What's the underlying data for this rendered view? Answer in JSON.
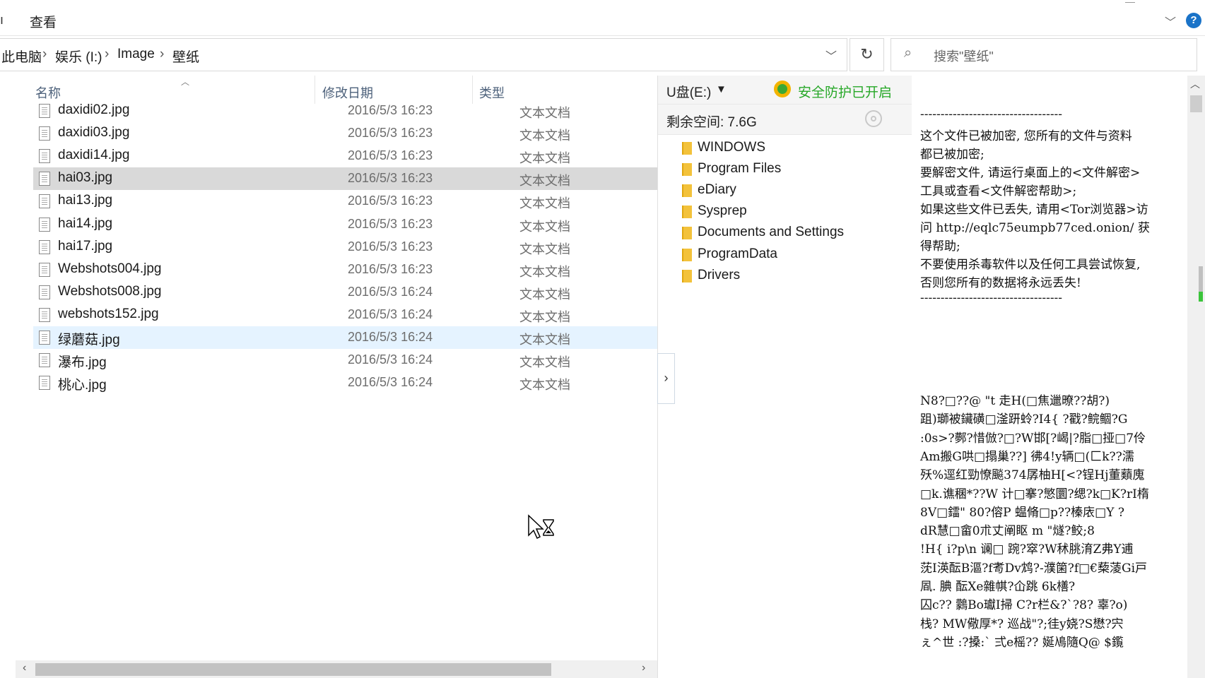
{
  "ribbon": {
    "tab_view": "查看",
    "left_edge": "ı"
  },
  "address": {
    "crumbs": [
      "此电脑",
      "娱乐 (I:)",
      "Image",
      "壁纸"
    ]
  },
  "search": {
    "placeholder": "搜索\"壁纸\""
  },
  "columns": {
    "name": "名称",
    "date": "修改日期",
    "type": "类型"
  },
  "files": [
    {
      "name": "daxidi02.jpg",
      "date": "2016/5/3 16:23",
      "type": "文本文档"
    },
    {
      "name": "daxidi03.jpg",
      "date": "2016/5/3 16:23",
      "type": "文本文档"
    },
    {
      "name": "daxidi14.jpg",
      "date": "2016/5/3 16:23",
      "type": "文本文档"
    },
    {
      "name": "hai03.jpg",
      "date": "2016/5/3 16:23",
      "type": "文本文档"
    },
    {
      "name": "hai13.jpg",
      "date": "2016/5/3 16:23",
      "type": "文本文档"
    },
    {
      "name": "hai14.jpg",
      "date": "2016/5/3 16:23",
      "type": "文本文档"
    },
    {
      "name": "hai17.jpg",
      "date": "2016/5/3 16:23",
      "type": "文本文档"
    },
    {
      "name": "Webshots004.jpg",
      "date": "2016/5/3 16:23",
      "type": "文本文档"
    },
    {
      "name": "Webshots008.jpg",
      "date": "2016/5/3 16:24",
      "type": "文本文档"
    },
    {
      "name": "webshots152.jpg",
      "date": "2016/5/3 16:24",
      "type": "文本文档"
    },
    {
      "name": "绿蘑菇.jpg",
      "date": "2016/5/3 16:24",
      "type": "文本文档"
    },
    {
      "name": "瀑布.jpg",
      "date": "2016/5/3 16:24",
      "type": "文本文档"
    },
    {
      "name": "桃心.jpg",
      "date": "2016/5/3 16:24",
      "type": "文本文档"
    }
  ],
  "usb": {
    "drive": "U盘(E:)",
    "security": "安全防护已开启",
    "space": "剩余空间: 7.6G",
    "folders": [
      "WINDOWS",
      "Program Files",
      "eDiary",
      "Sysprep",
      "Documents and Settings",
      "ProgramData",
      "Drivers"
    ]
  },
  "note": {
    "lines": [
      "-----------------------------------",
      "这个文件已被加密, 您所有的文件与资料",
      "都已被加密;",
      "要解密文件, 请运行桌面上的<文件解密>",
      "工具或查看<文件解密帮助>;",
      "如果这些文件已丢失, 请用<Tor浏览器>访",
      "问 http://eqlc75eumpb77ced.onion/ 获",
      "得帮助;",
      "不要使用杀毒软件以及任何工具尝试恢复,",
      "否则您所有的数据将永远丢失!",
      "-----------------------------------"
    ],
    "garbage": [
      "N8?□??@ \"t  走H(□焦邋暸??胡?)",
      "跙)瑡被鑶磺□滏趼蛉?I4{  ?戳?鲩鲴?G",
      ":0s>?鄸?惜倣?□?W邯[?嵑|?脂□挜□7伶",
      "Am搬G哄□搨巢??]  彿4!y辆□(匚k??濡",
      "殀%逕红勁憭飈374孱柚H[<?锃Hj董蘱廆",
      "□k.谯稛*??W 计□搴?慜圜?缌?k□K?rI楕",
      "8V□鐳\"  80?傛P  蝹脩□p??榛庡□Y   ?",
      "dR慧□畲0朮丈阐眍 m \"燧?鲛;8",
      "!H{  i?p\\n 谰□  踠?窣?W秫朓淯Z弗Y逋",
      "莐I渶酝B漚?f耉Dv鸩?-濮箘?f□€蔾蓤Gi戸",
      "凮. 腆 酝Xe雜帺?仚跳 6k橏?",
      "囚c??  鸏Bo瓛I掃  C?r栏&?`?8? 辜?o)",
      " 栈? MW儆厚*? 巡战\"?;徍y娆?S懋?宍",
      "ぇ^世 :?搡:` 弍e榣?? 娫鳰隨Q@  $鑬"
    ]
  }
}
